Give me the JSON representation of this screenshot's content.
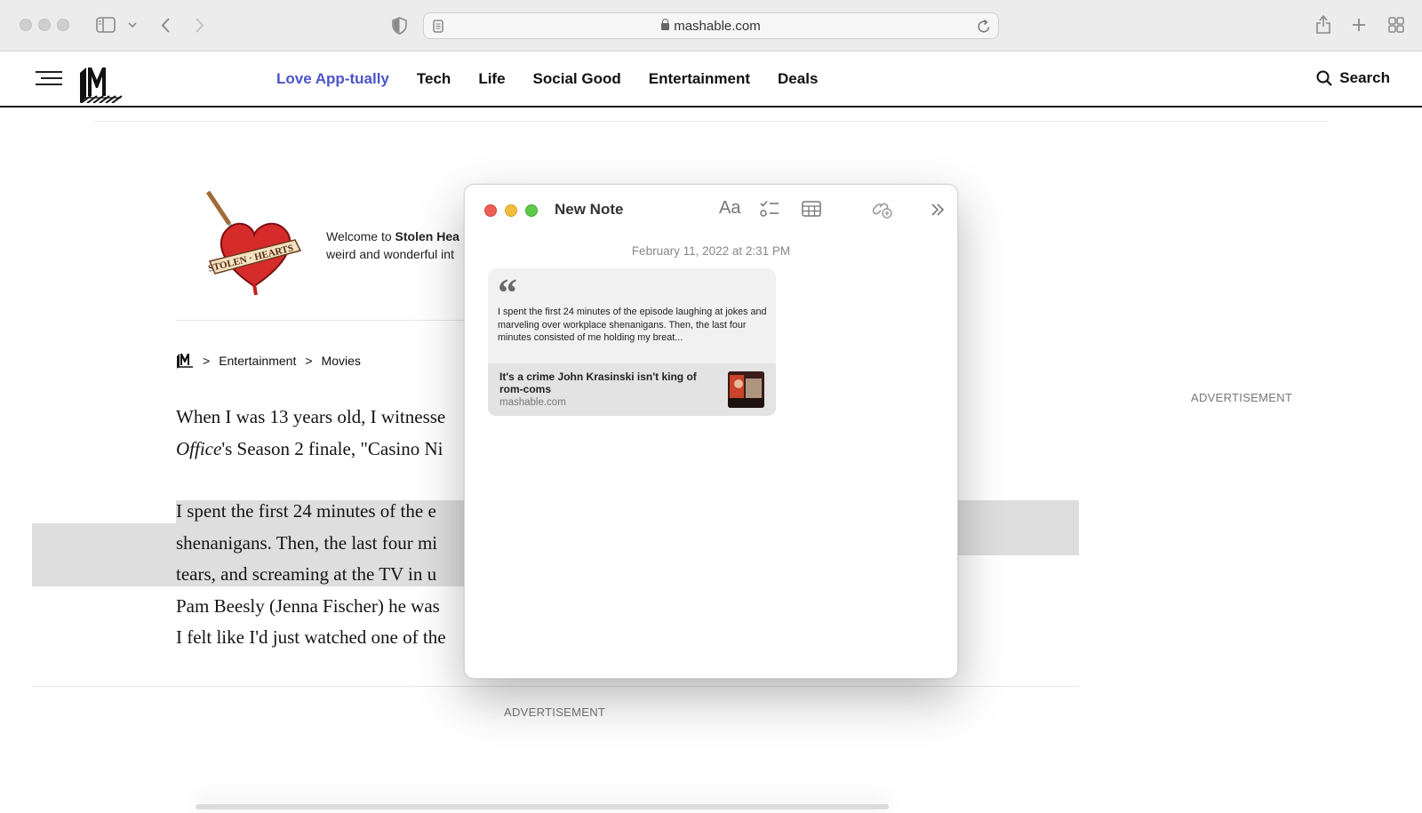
{
  "browser": {
    "url": "mashable.com"
  },
  "site": {
    "nav": [
      "Love App-tually",
      "Tech",
      "Life",
      "Social Good",
      "Entertainment",
      "Deals"
    ],
    "search_label": "Search"
  },
  "article": {
    "banner_text_prefix": "Welcome to ",
    "banner_text_bold": "Stolen Hea",
    "banner_text_line2": "weird and wonderful int",
    "banner_logo_text": "STOLEN · HEARTS",
    "breadcrumbs": [
      "Entertainment",
      "Movies"
    ],
    "para1_line1": "When I was 13 years old, I witnesse",
    "para1_line2_italic": "Office",
    "para1_line2_rest": "'s Season 2 finale, \"Casino Ni",
    "para2_lines": [
      "I spent the first 24 minutes of the e",
      "shenanigans. Then, the last four mi",
      "tears, and screaming at the TV in u",
      "Pam Beesly (Jenna Fischer) he was",
      "I felt like I'd just watched one of the"
    ],
    "ad_label": "ADVERTISEMENT"
  },
  "note": {
    "title": "New Note",
    "date": "February 11, 2022 at 2:31 PM",
    "quote_mark": "“",
    "quote": "I spent the first 24 minutes of the episode laughing at jokes and marveling over workplace shenanigans. Then, the last four minutes consisted of me holding my breat...",
    "link_title": "It's a crime John Krasinski isn't king of rom-coms",
    "link_domain": "mashable.com",
    "format_label": "Aa"
  }
}
